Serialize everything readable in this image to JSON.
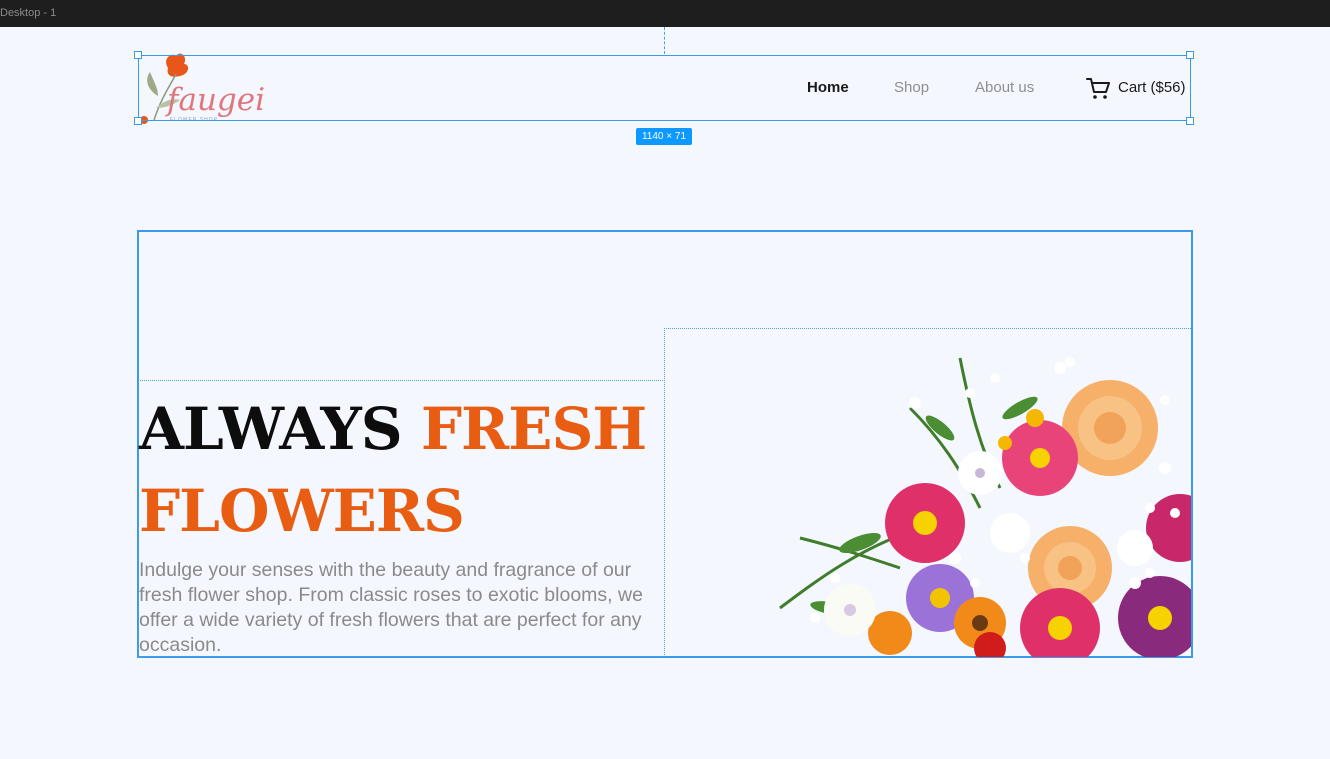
{
  "window": {
    "frame_label": "Desktop - 1"
  },
  "nav": {
    "logo_text": "faugei",
    "logo_subtext": "FLOWER SHOP",
    "links": [
      {
        "label": "Home",
        "active": true
      },
      {
        "label": "Shop",
        "active": false
      },
      {
        "label": "About us",
        "active": false
      }
    ],
    "cart_label": "Cart ($56)",
    "selection_size": "1140 × 71"
  },
  "hero": {
    "title_part1": "ALWAYS ",
    "title_part2": "FRESH",
    "title_part3": "FLOWERS",
    "description": "Indulge your senses with the beauty and fragrance of our fresh flower shop. From classic roses to exotic blooms, we offer a wide variety of fresh flowers that are perfect for any occasion.",
    "image": "flower-bouquet"
  },
  "colors": {
    "accent": "#e85d12",
    "selection": "#3b99ea",
    "badge": "#0d99ff",
    "background": "#f4f7fd"
  }
}
